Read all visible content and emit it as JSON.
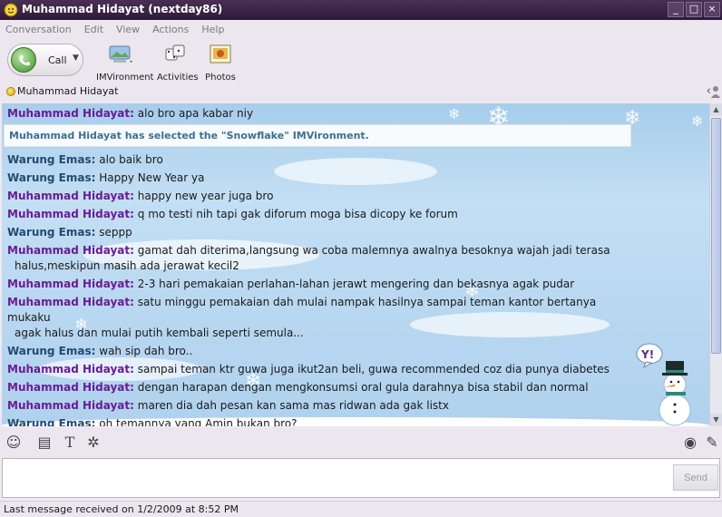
{
  "window": {
    "title": "Muhammad Hidayat (nextday86)",
    "controls": [
      "_",
      "□",
      "×"
    ]
  },
  "menu": [
    "Conversation",
    "Edit",
    "View",
    "Actions",
    "Help"
  ],
  "toolbar": {
    "call_label": "Call",
    "imvironment_label": "IMVironment",
    "activities_label": "Activities",
    "photos_label": "Photos"
  },
  "contact": {
    "name": "Muhammad Hidayat",
    "status_color": "#f1c21b"
  },
  "conversation": {
    "messages": [
      {
        "sender": "Muhammad Hidayat:",
        "text": "alo bro apa kabar niy",
        "cont": ""
      },
      {
        "sender": "Warung Emas:",
        "text": "alo baik bro",
        "cont": ""
      },
      {
        "sender": "Warung Emas:",
        "text": "Happy New Year ya",
        "cont": ""
      },
      {
        "sender": "Muhammad Hidayat:",
        "text": "happy new year juga bro",
        "cont": ""
      },
      {
        "sender": "Muhammad Hidayat:",
        "text": "q mo testi nih tapi gak diforum moga bisa dicopy ke forum",
        "cont": ""
      },
      {
        "sender": "Warung Emas:",
        "text": "seppp",
        "cont": ""
      },
      {
        "sender": "Muhammad Hidayat:",
        "text": "gamat dah diterima,langsung wa coba malemnya awalnya besoknya wajah jadi terasa",
        "cont": "halus,meskipun masih ada jerawat kecil2"
      },
      {
        "sender": "Muhammad Hidayat:",
        "text": "2-3 hari pemakaian perlahan-lahan jerawt mengering dan bekasnya agak pudar",
        "cont": ""
      },
      {
        "sender": "Muhammad Hidayat:",
        "text": "satu minggu pemakaian dah mulai nampak hasilnya sampai teman kantor bertanya mukaku",
        "cont": "agak halus dan mulai putih kembali seperti semula..."
      },
      {
        "sender": "Warung Emas:",
        "text": "wah sip dah bro..",
        "cont": ""
      },
      {
        "sender": "Muhammad Hidayat:",
        "text": "sampai teman ktr guwa juga ikut2an beli, guwa recommended coz dia punya diabetes",
        "cont": ""
      },
      {
        "sender": "Muhammad Hidayat:",
        "text": "dengan harapan dengan mengkonsumsi oral gula darahnya bisa stabil dan normal",
        "cont": ""
      },
      {
        "sender": "Muhammad Hidayat:",
        "text": "maren dia dah pesan kan sama mas ridwan ada gak listx",
        "cont": ""
      },
      {
        "sender": "Warung Emas:",
        "text": "oh temannya yang Amin bukan bro?",
        "cont": ""
      }
    ],
    "system_notice": "Muhammad Hidayat has selected the \"Snowflake\" IMVironment.",
    "snowman_badge": "Y!"
  },
  "input": {
    "value": "",
    "send_label": "Send"
  },
  "status_bar": {
    "text": "Last message received on 1/2/2009 at 8:52 PM"
  },
  "colors": {
    "sender_self": "#6a1c94",
    "sender_other": "#244b71",
    "title_bar": "#3b2446",
    "background": "#b7d6f0"
  }
}
